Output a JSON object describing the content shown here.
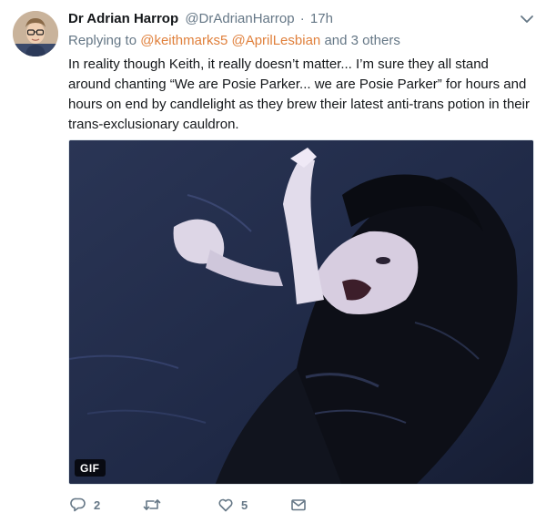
{
  "tweet": {
    "display_name": "Dr Adrian Harrop",
    "handle": "@DrAdrianHarrop",
    "separator": "·",
    "time": "17h",
    "replying_prefix": "Replying to",
    "replying_mention_1": "@keithmarks5",
    "replying_mention_2": "@AprilLesbian",
    "replying_suffix": "and 3 others",
    "text": "In reality though Keith, it really doesn’t matter... I’m sure they all stand around chanting “We are Posie Parker... we are Posie Parker” for hours and hours on end by candlelight as they brew their latest anti-trans potion in their trans-exclusionary cauldron.",
    "media_badge": "GIF"
  },
  "actions": {
    "reply_count": "2",
    "retweet_count": "",
    "like_count": "5"
  },
  "icons": {
    "menu": "chevron-down-icon",
    "reply": "reply-icon",
    "retweet": "retweet-icon",
    "like": "heart-icon",
    "dm": "envelope-icon"
  },
  "colors": {
    "mention": "#e0803c",
    "secondary_text": "#657786",
    "primary_text": "#14171a"
  }
}
